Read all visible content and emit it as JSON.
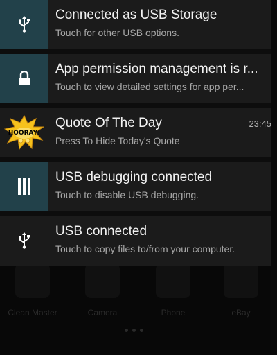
{
  "launcher": {
    "apps": [
      {
        "label": "Clean Master",
        "icon": "clean-master-icon"
      },
      {
        "label": "Camera",
        "icon": "camera-icon"
      },
      {
        "label": "Phone",
        "icon": "phone-icon"
      },
      {
        "label": "eBay",
        "icon": "ebay-icon"
      }
    ]
  },
  "notifications": [
    {
      "title": "Connected as USB Storage",
      "text": "Touch for other USB options.",
      "icon": "usb-icon",
      "icon_bg": "#22414a"
    },
    {
      "title": "App permission management is r...",
      "text": "Touch to view detailed settings for app per...",
      "icon": "lock-icon",
      "icon_bg": "#22414a"
    },
    {
      "title": "Quote Of The Day",
      "text": "Press To Hide Today's Quote",
      "time": "23:45",
      "icon": "hooray-icon",
      "icon_text": "HOORAY!"
    },
    {
      "title": "USB debugging connected",
      "text": "Touch to disable USB debugging.",
      "icon": "usb-debugging-icon",
      "icon_bg": "#22414a"
    },
    {
      "title": "USB connected",
      "text": "Touch to copy files to/from your computer.",
      "icon": "usb-icon"
    }
  ],
  "colors": {
    "card_bg": "#1b1b1b",
    "icon_teal": "#22414a",
    "title": "#f2f2f2",
    "text": "#a8a8a8"
  }
}
